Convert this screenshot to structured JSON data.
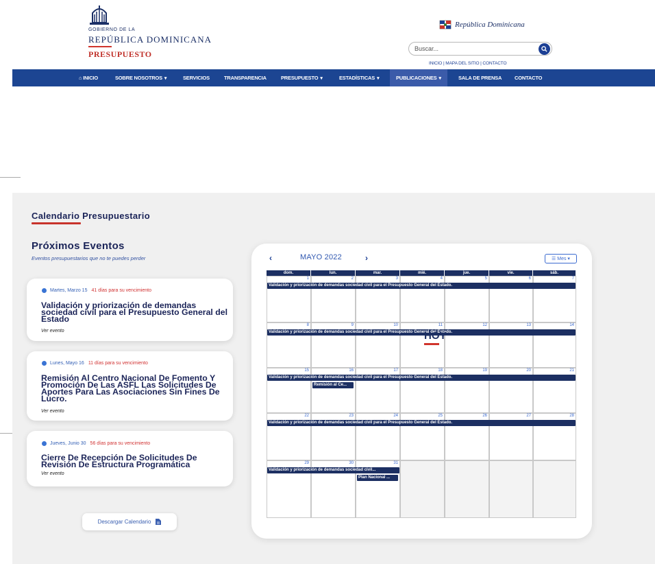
{
  "header": {
    "gob_line": "GOBIERNO DE LA",
    "rep_line": "REPÚBLICA DOMINICANA",
    "presupuesto_line": "PRESUPUESTO",
    "rd_logo_text": "República Dominicana",
    "search_placeholder": "Buscar...",
    "top_links": "INICIO | MAPA DEL SITIO | CONTACTO",
    "brand_color": "#1c4592",
    "accent_color": "#c8332b"
  },
  "nav": {
    "items": [
      {
        "label": "INICIO",
        "icon": "home-icon"
      },
      {
        "label": "SOBRE NOSOTROS",
        "dropdown": true
      },
      {
        "label": "SERVICIOS"
      },
      {
        "label": "TRANSPARENCIA"
      },
      {
        "label": "PRESUPUESTO",
        "dropdown": true
      },
      {
        "label": "ESTADÍSTICAS",
        "dropdown": true
      },
      {
        "label": "PUBLICACIONES",
        "dropdown": true,
        "active": true
      },
      {
        "label": "SALA DE PRENSA"
      },
      {
        "label": "CONTACTO"
      }
    ]
  },
  "section": {
    "title": "Calendario Presupuestario",
    "upcoming_title": "Próximos Eventos",
    "upcoming_subtitle": "Eventos presupuestarios que no te puedes perder",
    "download_label": "Descargar Calendario"
  },
  "events": [
    {
      "date": "Martes, Marzo 15",
      "days": "41 días para su vencimiento",
      "title": "Validación y priorización de demandas sociedad civil para el Presupuesto General del Estado",
      "link": "Ver evento"
    },
    {
      "date": "Lunes, Mayo 16",
      "days": "11 días para su vencimiento",
      "title": "Remisión Al Centro Nacional De Fomento Y Promoción De Las ASFL Las Solicitudes De Aportes Para Las Asociaciones Sin Fines De Lucro.",
      "link": "Ver evento"
    },
    {
      "date": "Jueves, Junio 30",
      "days": "56 días para su vencimiento",
      "title": "Cierre De Recepción De Solicitudes De Revisión De Estructura Programática",
      "link": "Ver evento"
    }
  ],
  "calendar": {
    "prev": "‹",
    "next": "›",
    "title": "MAYO 2022",
    "view_label": "☰ Mes ▾",
    "today_label": "HOY",
    "weekdays": [
      "dom.",
      "lun.",
      "mar.",
      "mié.",
      "jue.",
      "vie.",
      "sáb."
    ],
    "weeks": [
      [
        "1",
        "2",
        "3",
        "4",
        "5",
        "6",
        "7"
      ],
      [
        "8",
        "9",
        "10",
        "11",
        "12",
        "13",
        "14"
      ],
      [
        "15",
        "16",
        "17",
        "18",
        "19",
        "20",
        "21"
      ],
      [
        "22",
        "23",
        "24",
        "25",
        "26",
        "27",
        "28"
      ],
      [
        "29",
        "30",
        "31",
        "",
        "",
        "",
        ""
      ]
    ],
    "bar_full": "Validación y priorización de demandas sociedad civil para el Presupuesto General del Estado.",
    "bar_short": "Validación y priorización de demandas sociedad civil...",
    "remision_short": "Remisión al Ce...",
    "plan_short": "Plan Nacional ..."
  }
}
